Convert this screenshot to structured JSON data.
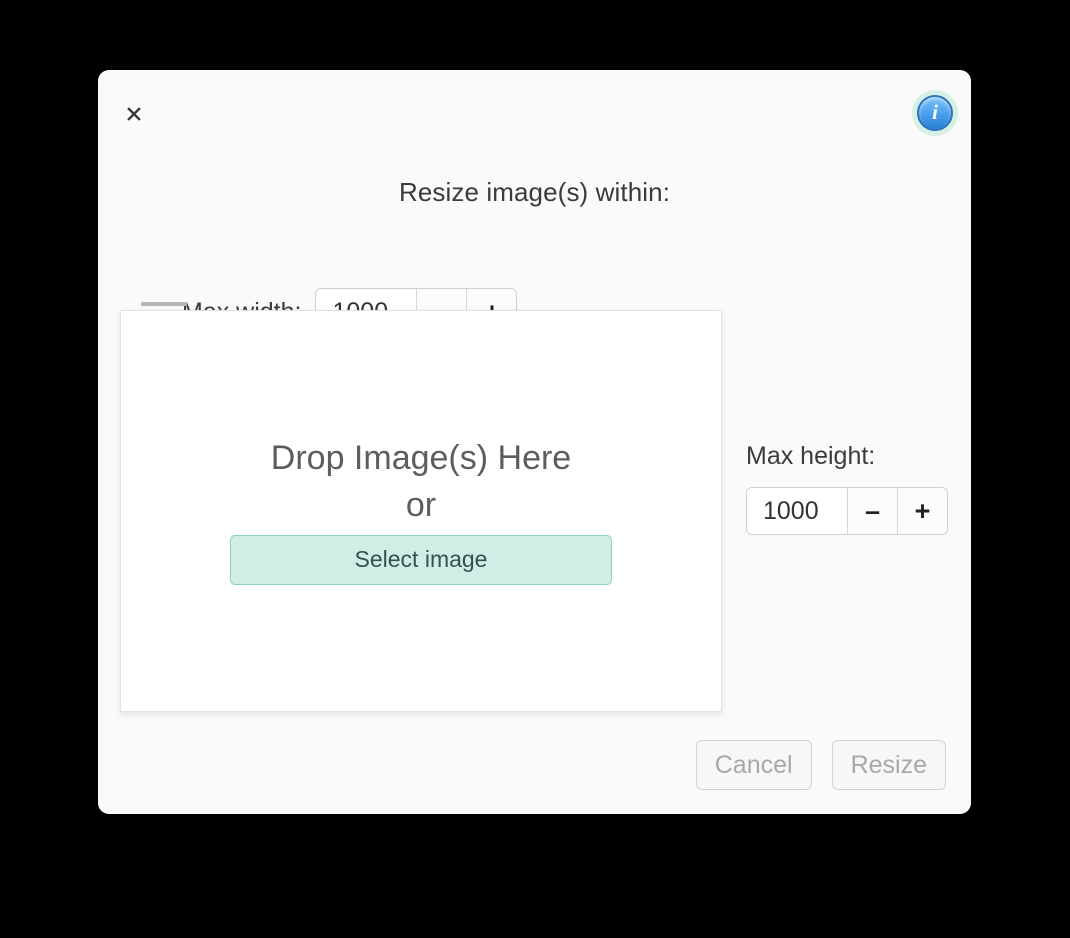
{
  "dialog": {
    "title": "Resize image(s) within:",
    "close_icon": "close-x-icon",
    "info_icon": "info-icon",
    "info_glyph": "i"
  },
  "width_field": {
    "label": "Max width:",
    "value": "1000",
    "placeholder": "1000",
    "decrement_label": "–",
    "increment_label": "+"
  },
  "height_field": {
    "label": "Max height:",
    "value": "1000",
    "placeholder": "1000",
    "decrement_label": "–",
    "increment_label": "+"
  },
  "drop_zone": {
    "headline": "Drop Image(s) Here",
    "or_label": "or",
    "select_label": "Select image"
  },
  "footer": {
    "cancel_label": "Cancel",
    "resize_label": "Resize"
  },
  "colors": {
    "accent_mint": "#cfeee6",
    "accent_mint_border": "#8fd3c2",
    "info_blue": "#4ea3ef",
    "dialog_bg": "#fafafa",
    "page_bg": "#000000",
    "disabled_text": "#a8a8a8"
  }
}
